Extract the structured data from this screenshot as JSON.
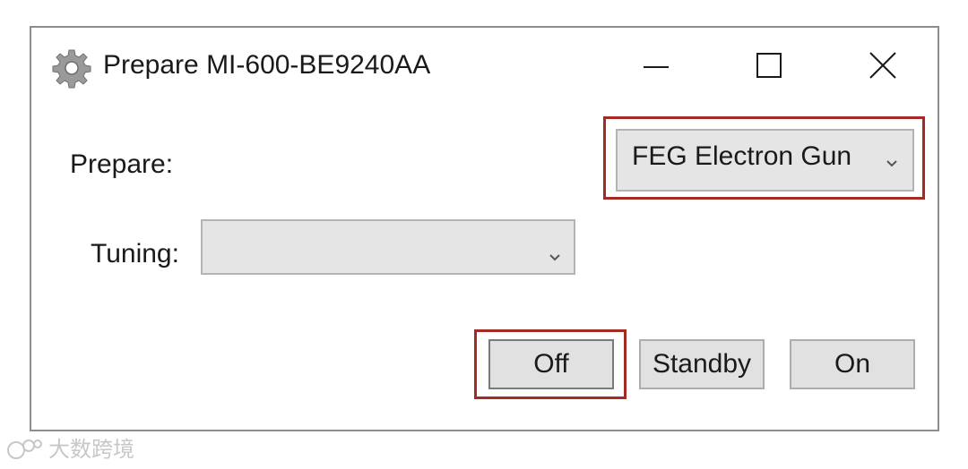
{
  "window": {
    "title": "Prepare MI-600-BE9240AA",
    "icon": "gear-icon",
    "controls": [
      "minimize-icon",
      "maximize-icon",
      "close-icon"
    ]
  },
  "form": {
    "prepare_label": "Prepare:",
    "prepare_value": "FEG Electron Gun",
    "tuning_label": "Tuning:",
    "tuning_value": ""
  },
  "buttons": {
    "off": "Off",
    "standby": "Standby",
    "on": "On"
  },
  "highlight_color": "#a32b22",
  "watermark": {
    "text": "大数跨境"
  }
}
